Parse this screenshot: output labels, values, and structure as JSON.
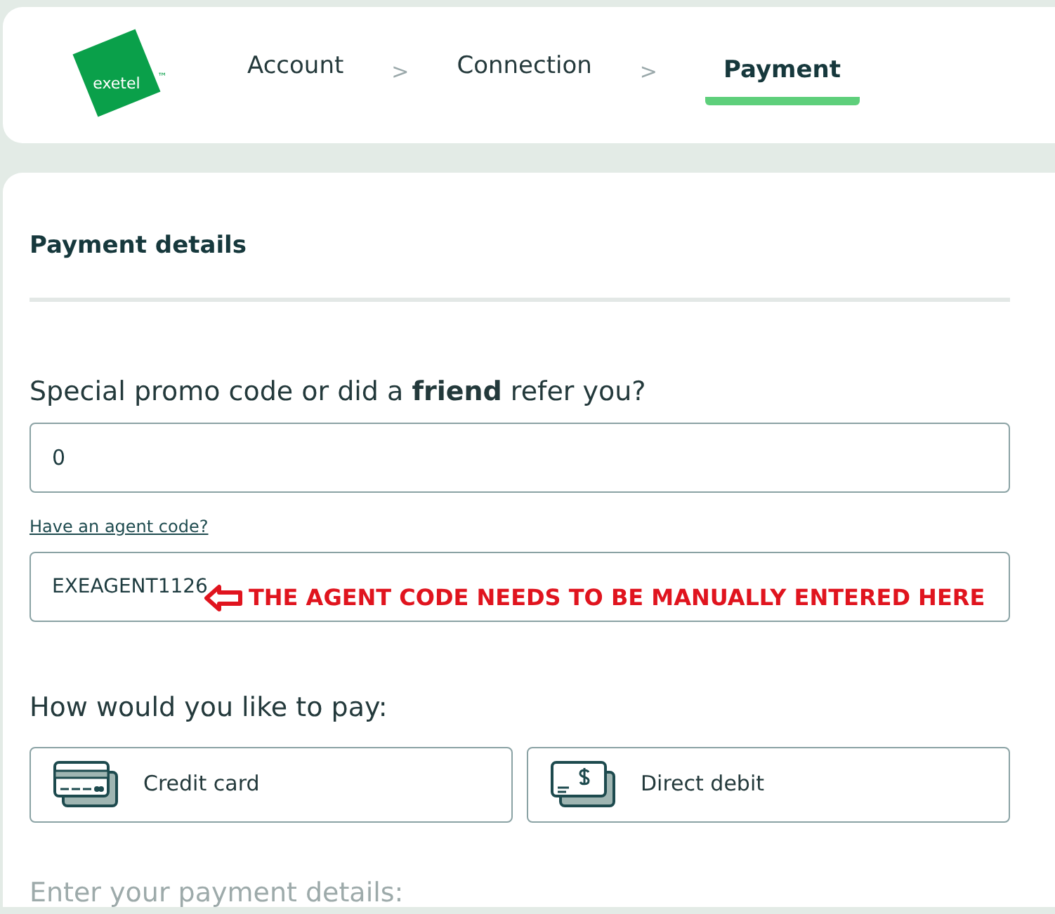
{
  "header": {
    "logo": "exetel",
    "logo_mark": "™",
    "steps": [
      {
        "label": "Account",
        "selected": false
      },
      {
        "label": "Connection",
        "selected": false
      },
      {
        "label": "Payment",
        "selected": true
      }
    ],
    "separators": [
      ">",
      ">"
    ]
  },
  "section_title": "Payment details",
  "promo": {
    "label": "Special promo code or did a **friend** refer you?",
    "value": "0"
  },
  "agent_link": "Have an agent code?",
  "agent": {
    "value": "EXEAGENT1126",
    "annotation": "THE AGENT CODE NEEDS TO BE MANUALLY ENTERED HERE"
  },
  "pay_question": "How would you like to pay:",
  "pay_options": [
    {
      "kind": "card",
      "label": "Credit card",
      "selected": false
    },
    {
      "kind": "debit",
      "label": "Direct debit",
      "selected": false
    }
  ],
  "next_heading": "Enter your payment details:"
}
